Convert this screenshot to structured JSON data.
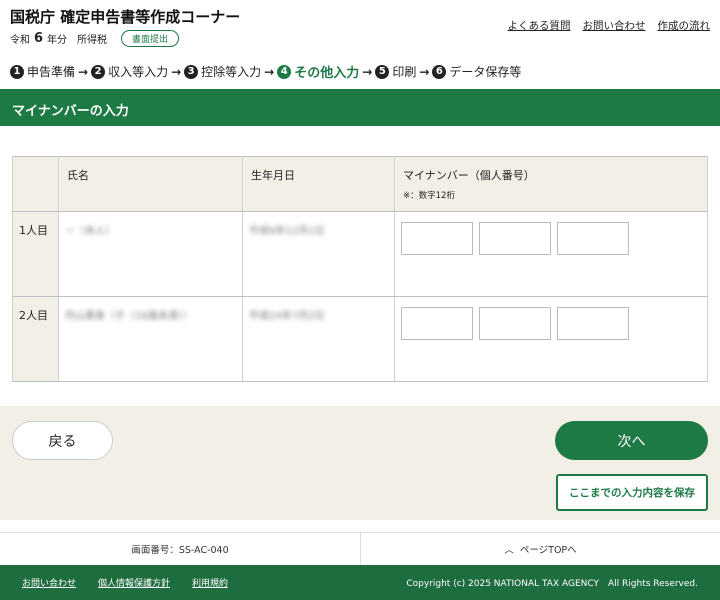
{
  "header": {
    "title": "国税庁 確定申告書等作成コーナー",
    "era": "令和",
    "year": "6",
    "year_suffix": "年分",
    "tax_type": "所得税",
    "badge": "書面提出",
    "links": [
      "よくある質問",
      "お問い合わせ",
      "作成の流れ"
    ]
  },
  "steps": [
    {
      "num": "1",
      "label": "申告準備"
    },
    {
      "num": "2",
      "label": "収入等入力"
    },
    {
      "num": "3",
      "label": "控除等入力"
    },
    {
      "num": "4",
      "label": "その他入力",
      "active": true
    },
    {
      "num": "5",
      "label": "印刷"
    },
    {
      "num": "6",
      "label": "データ保存等"
    }
  ],
  "section": {
    "title": "マイナンバーの入力"
  },
  "table": {
    "headers": {
      "name": "氏名",
      "birth": "生年月日",
      "mynumber": "マイナンバー（個人番号）",
      "note": "※：数字12桁"
    },
    "rows": [
      {
        "label": "1人目",
        "name": "ー（本人）",
        "birth": "平成9年12月1日"
      },
      {
        "label": "2人目",
        "name": "丹山恵美（子（16歳未満））",
        "birth": "平成24年7月2日"
      }
    ]
  },
  "actions": {
    "back": "戻る",
    "next": "次へ",
    "save": "ここまでの入力内容を保存"
  },
  "info": {
    "screen_id": "画面番号：SS-AC-040",
    "page_top": "ページTOPへ"
  },
  "footer": {
    "links": [
      "お問い合わせ",
      "個人情報保護方針",
      "利用規約"
    ],
    "copyright": "Copyright (c) 2025 NATIONAL TAX AGENCY　All Rights Reserved."
  }
}
